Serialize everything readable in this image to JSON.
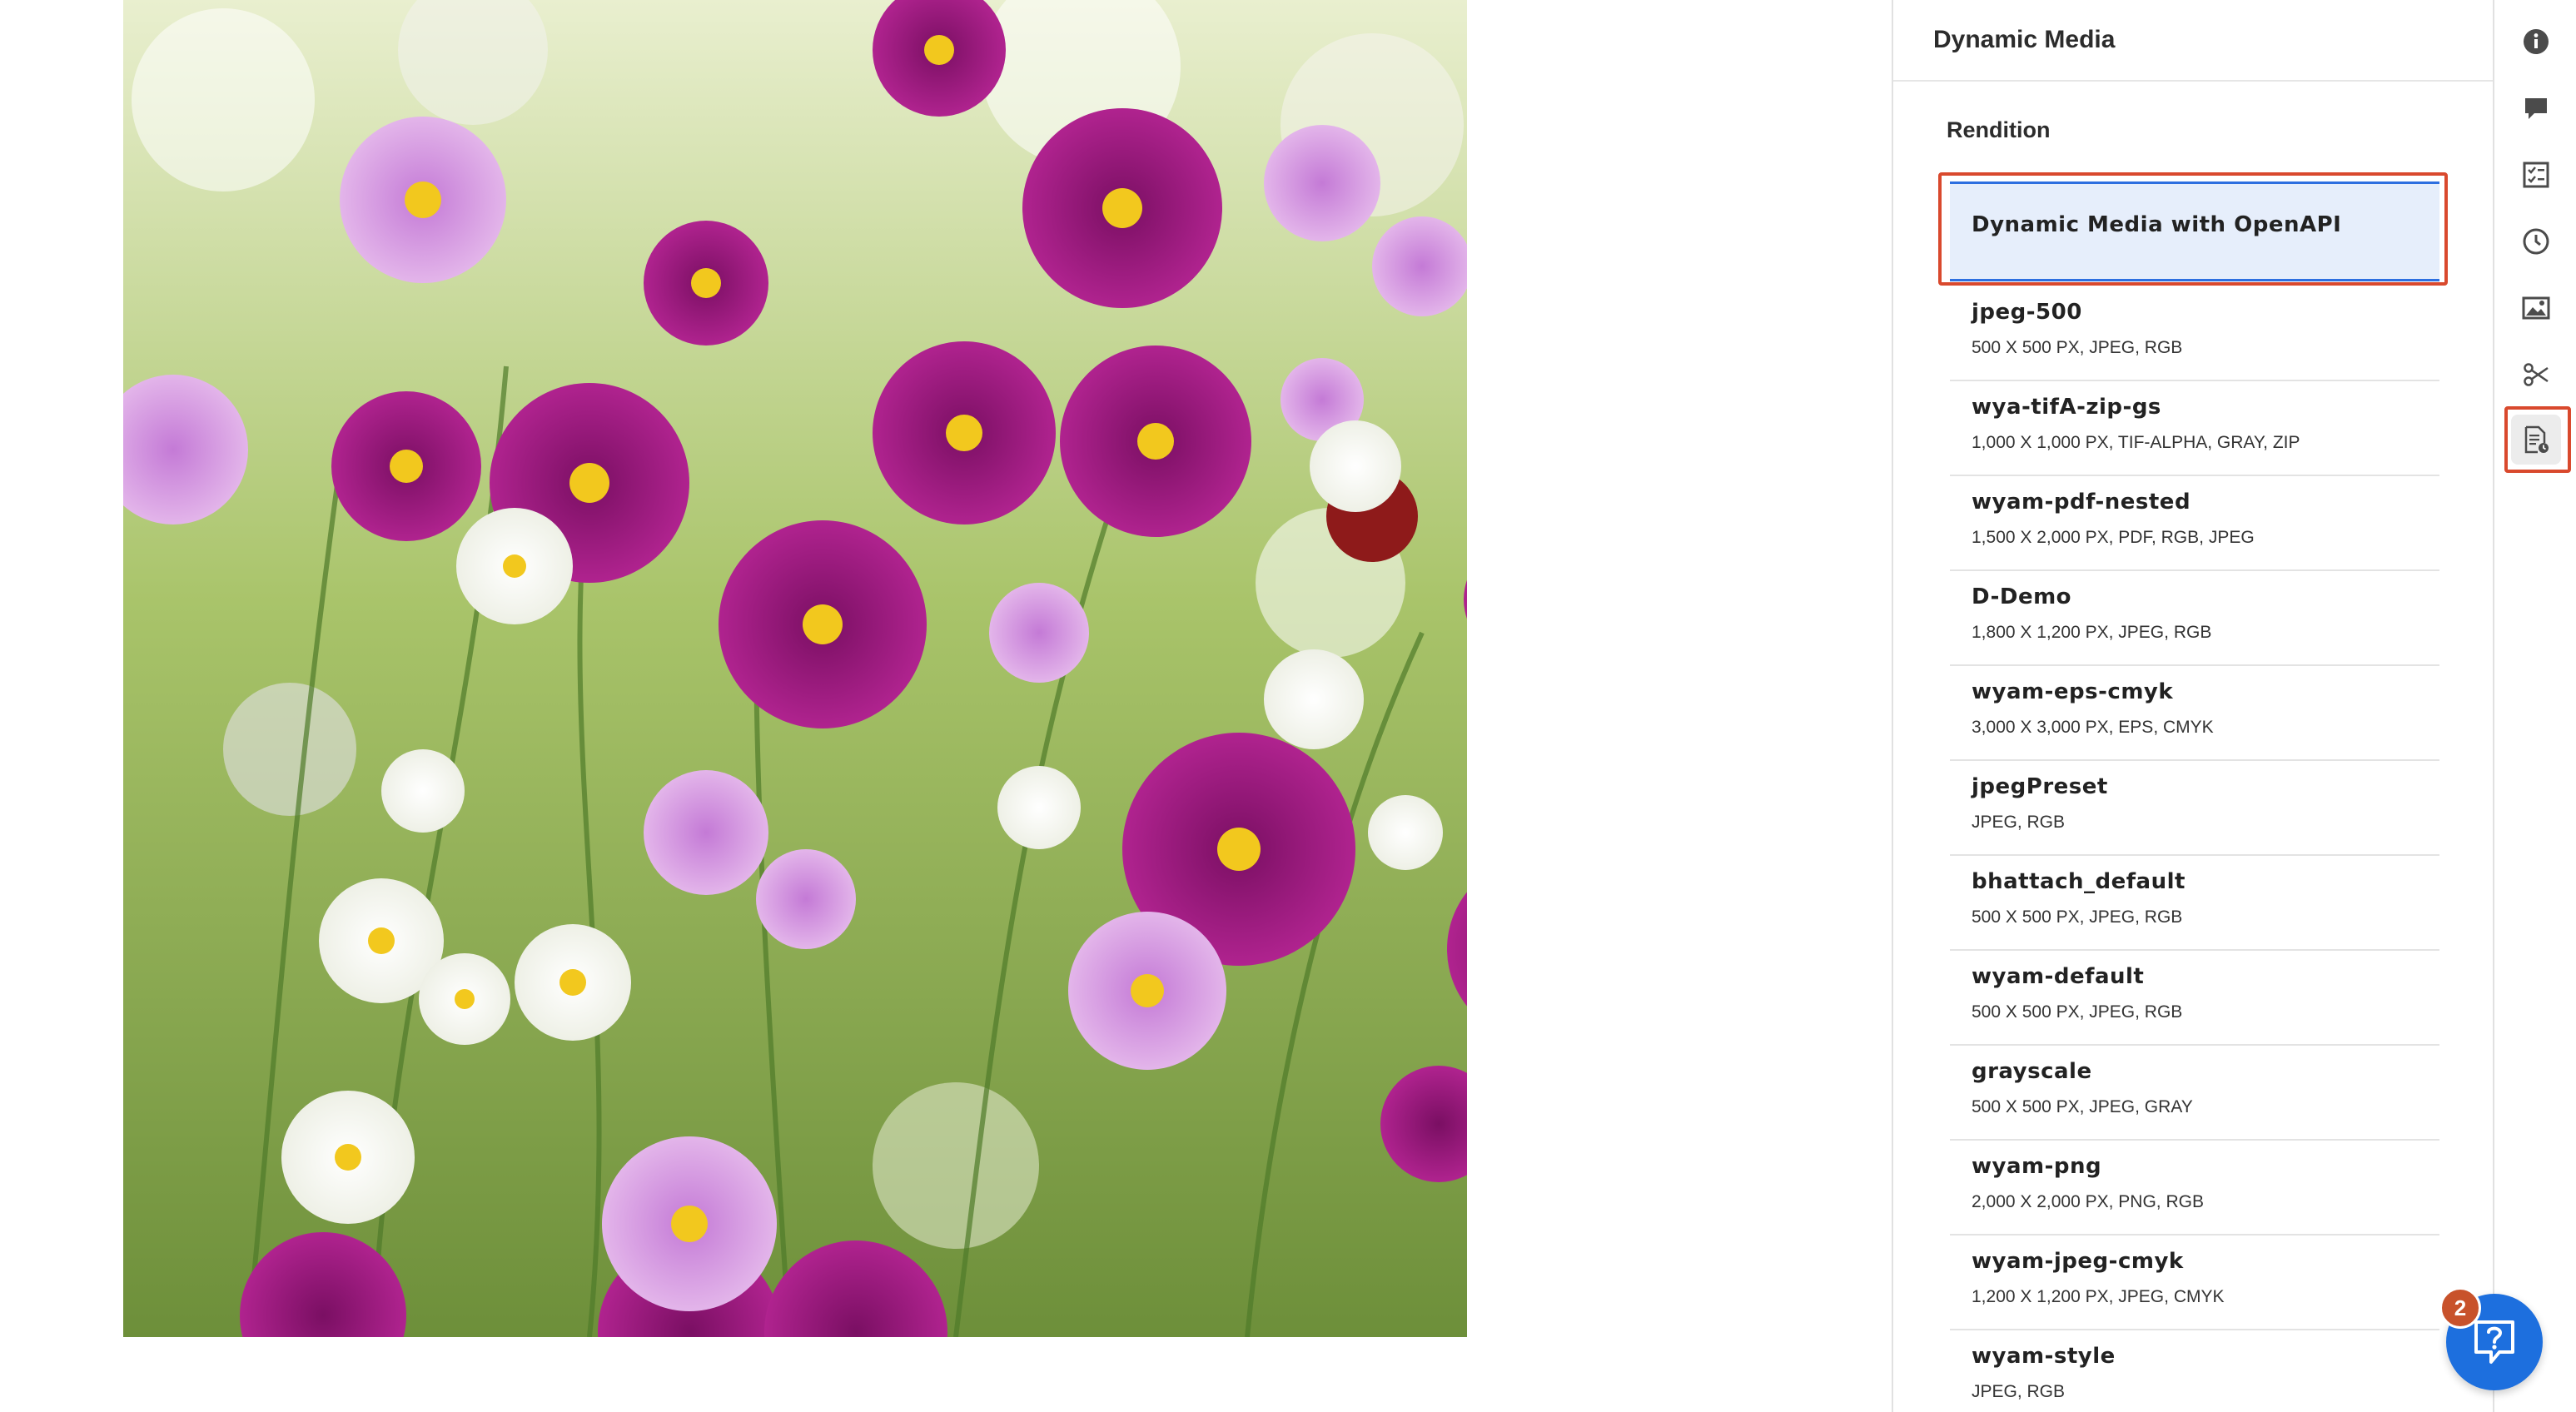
{
  "panel": {
    "title": "Dynamic Media",
    "section_label": "Rendition",
    "selected_rendition": "Dynamic Media with OpenAPI",
    "renditions": [
      {
        "name": "jpeg-500",
        "meta": "500 X 500 PX, JPEG, RGB"
      },
      {
        "name": "wya-tifA-zip-gs",
        "meta": "1,000 X 1,000 PX, TIF-ALPHA, GRAY, ZIP"
      },
      {
        "name": "wyam-pdf-nested",
        "meta": "1,500 X 2,000 PX, PDF, RGB, JPEG"
      },
      {
        "name": "D-Demo",
        "meta": "1,800 X 1,200 PX, JPEG, RGB"
      },
      {
        "name": "wyam-eps-cmyk",
        "meta": "3,000 X 3,000 PX, EPS, CMYK"
      },
      {
        "name": "jpegPreset",
        "meta": "JPEG, RGB"
      },
      {
        "name": "bhattach_default",
        "meta": "500 X 500 PX, JPEG, RGB"
      },
      {
        "name": "wyam-default",
        "meta": "500 X 500 PX, JPEG, RGB"
      },
      {
        "name": "grayscale",
        "meta": "500 X 500 PX, JPEG, GRAY"
      },
      {
        "name": "wyam-png",
        "meta": "2,000 X 2,000 PX, PNG, RGB"
      },
      {
        "name": "wyam-jpeg-cmyk",
        "meta": "1,200 X 1,200 PX, JPEG, CMYK"
      },
      {
        "name": "wyam-style",
        "meta": "JPEG, RGB"
      }
    ]
  },
  "rail": {
    "icons": [
      "info-icon",
      "comment-icon",
      "checklist-icon",
      "history-icon",
      "image-icon",
      "cut-icon",
      "dynamic-media-icon"
    ],
    "active": "dynamic-media-icon"
  },
  "help": {
    "badge_count": "2",
    "icon": "help-question-icon"
  },
  "colors": {
    "accent": "#2d6fe0",
    "selection_bg": "#e6eefb",
    "highlight": "#d9492d",
    "help_button": "#1d6fde",
    "badge": "#c8522b"
  }
}
